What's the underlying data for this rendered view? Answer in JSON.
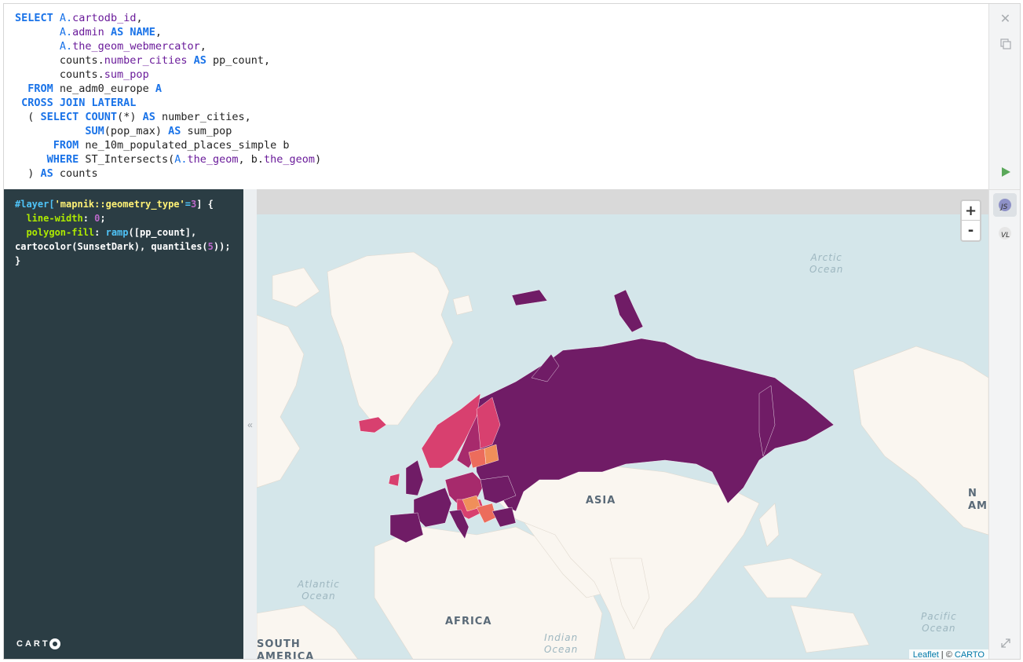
{
  "sql": {
    "lines": [
      [
        {
          "t": "SELECT ",
          "c": "kw"
        },
        {
          "t": "A.",
          "c": "al"
        },
        {
          "t": "cartodb_id",
          "c": "fld"
        },
        {
          "t": ",",
          "c": ""
        }
      ],
      [
        {
          "t": "       ",
          "c": ""
        },
        {
          "t": "A.",
          "c": "al"
        },
        {
          "t": "admin ",
          "c": "fld"
        },
        {
          "t": "AS ",
          "c": "kw"
        },
        {
          "t": "NAME",
          "c": "kw"
        },
        {
          "t": ",",
          "c": ""
        }
      ],
      [
        {
          "t": "       ",
          "c": ""
        },
        {
          "t": "A.",
          "c": "al"
        },
        {
          "t": "the_geom_webmercator",
          "c": "fld"
        },
        {
          "t": ",",
          "c": ""
        }
      ],
      [
        {
          "t": "       counts.",
          "c": ""
        },
        {
          "t": "number_cities ",
          "c": "fld"
        },
        {
          "t": "AS ",
          "c": "kw"
        },
        {
          "t": "pp_count,",
          "c": ""
        }
      ],
      [
        {
          "t": "       counts.",
          "c": ""
        },
        {
          "t": "sum_pop",
          "c": "fld"
        }
      ],
      [
        {
          "t": "  ",
          "c": ""
        },
        {
          "t": "FROM ",
          "c": "kw"
        },
        {
          "t": "ne_adm0_europe ",
          "c": ""
        },
        {
          "t": "A",
          "c": "kw"
        }
      ],
      [
        {
          "t": " ",
          "c": ""
        },
        {
          "t": "CROSS JOIN LATERAL",
          "c": "kw"
        }
      ],
      [
        {
          "t": "  ( ",
          "c": ""
        },
        {
          "t": "SELECT ",
          "c": "kw"
        },
        {
          "t": "COUNT",
          "c": "kw"
        },
        {
          "t": "(*) ",
          "c": ""
        },
        {
          "t": "AS ",
          "c": "kw"
        },
        {
          "t": "number_cities,",
          "c": ""
        }
      ],
      [
        {
          "t": "           ",
          "c": ""
        },
        {
          "t": "SUM",
          "c": "kw"
        },
        {
          "t": "(pop_max) ",
          "c": ""
        },
        {
          "t": "AS ",
          "c": "kw"
        },
        {
          "t": "sum_pop",
          "c": ""
        }
      ],
      [
        {
          "t": "      ",
          "c": ""
        },
        {
          "t": "FROM ",
          "c": "kw"
        },
        {
          "t": "ne_10m_populated_places_simple b",
          "c": ""
        }
      ],
      [
        {
          "t": "     ",
          "c": ""
        },
        {
          "t": "WHERE ",
          "c": "kw"
        },
        {
          "t": "ST_Intersects(",
          "c": ""
        },
        {
          "t": "A.",
          "c": "al"
        },
        {
          "t": "the_geom",
          "c": "fld"
        },
        {
          "t": ", b.",
          "c": ""
        },
        {
          "t": "the_geom",
          "c": "fld"
        },
        {
          "t": ")",
          "c": ""
        }
      ],
      [
        {
          "t": "  ) ",
          "c": ""
        },
        {
          "t": "AS ",
          "c": "kw"
        },
        {
          "t": "counts",
          "c": ""
        }
      ]
    ]
  },
  "cartocss": {
    "lines": [
      [
        {
          "t": "#layer[",
          "c": "c-sel"
        },
        {
          "t": "'mapnik::geometry_type'",
          "c": "c-str"
        },
        {
          "t": "=",
          "c": "c-sel"
        },
        {
          "t": "3",
          "c": "c-num"
        },
        {
          "t": "] {",
          "c": ""
        }
      ],
      [
        {
          "t": "  ",
          "c": ""
        },
        {
          "t": "line-width",
          "c": "c-prop"
        },
        {
          "t": ": ",
          "c": ""
        },
        {
          "t": "0",
          "c": "c-num"
        },
        {
          "t": ";",
          "c": ""
        }
      ],
      [
        {
          "t": "  ",
          "c": ""
        },
        {
          "t": "polygon-fill",
          "c": "c-prop"
        },
        {
          "t": ": ",
          "c": ""
        },
        {
          "t": "ramp",
          "c": "c-fn"
        },
        {
          "t": "([pp_count],",
          "c": ""
        }
      ],
      [
        {
          "t": "cartocolor(SunsetDark), quantiles(",
          "c": ""
        },
        {
          "t": "5",
          "c": "c-num"
        },
        {
          "t": "));",
          "c": ""
        }
      ],
      [
        {
          "t": "}",
          "c": ""
        }
      ]
    ]
  },
  "brand": {
    "logo_text": "CART"
  },
  "toolbar": {
    "close_icon": "close-icon",
    "copy_icon": "copy-icon",
    "run_icon": "play-icon",
    "expand_icon": "expand-icon",
    "libs": [
      {
        "label": "JS",
        "active": true,
        "color": "#8e91c7"
      },
      {
        "label": "VL",
        "active": false,
        "color": "#eeeeee"
      }
    ]
  },
  "collapse": {
    "glyph": "«"
  },
  "map": {
    "zoom_in": "+",
    "zoom_out": "-",
    "attribution_leaflet": "Leaflet",
    "attribution_sep": " | © ",
    "attribution_carto": "CARTO",
    "labels": {
      "arctic": [
        "Arctic",
        "Ocean"
      ],
      "atlantic": [
        "Atlantic",
        "Ocean"
      ],
      "indian": [
        "Indian",
        "Ocean"
      ],
      "pacific": [
        "Pacific",
        "Ocean"
      ],
      "asia": "ASIA",
      "africa": "AFRICA",
      "south_america": [
        "SOUTH",
        "AMERICA"
      ],
      "north_america_partial": [
        "N",
        "AM"
      ]
    },
    "colors": {
      "water": "#d4e6ea",
      "land": "#faf6f0",
      "class1": "#701c66",
      "class2": "#a72a6c",
      "class3": "#d8406f",
      "class4": "#ec6c5c",
      "class5": "#f08f5a"
    }
  }
}
